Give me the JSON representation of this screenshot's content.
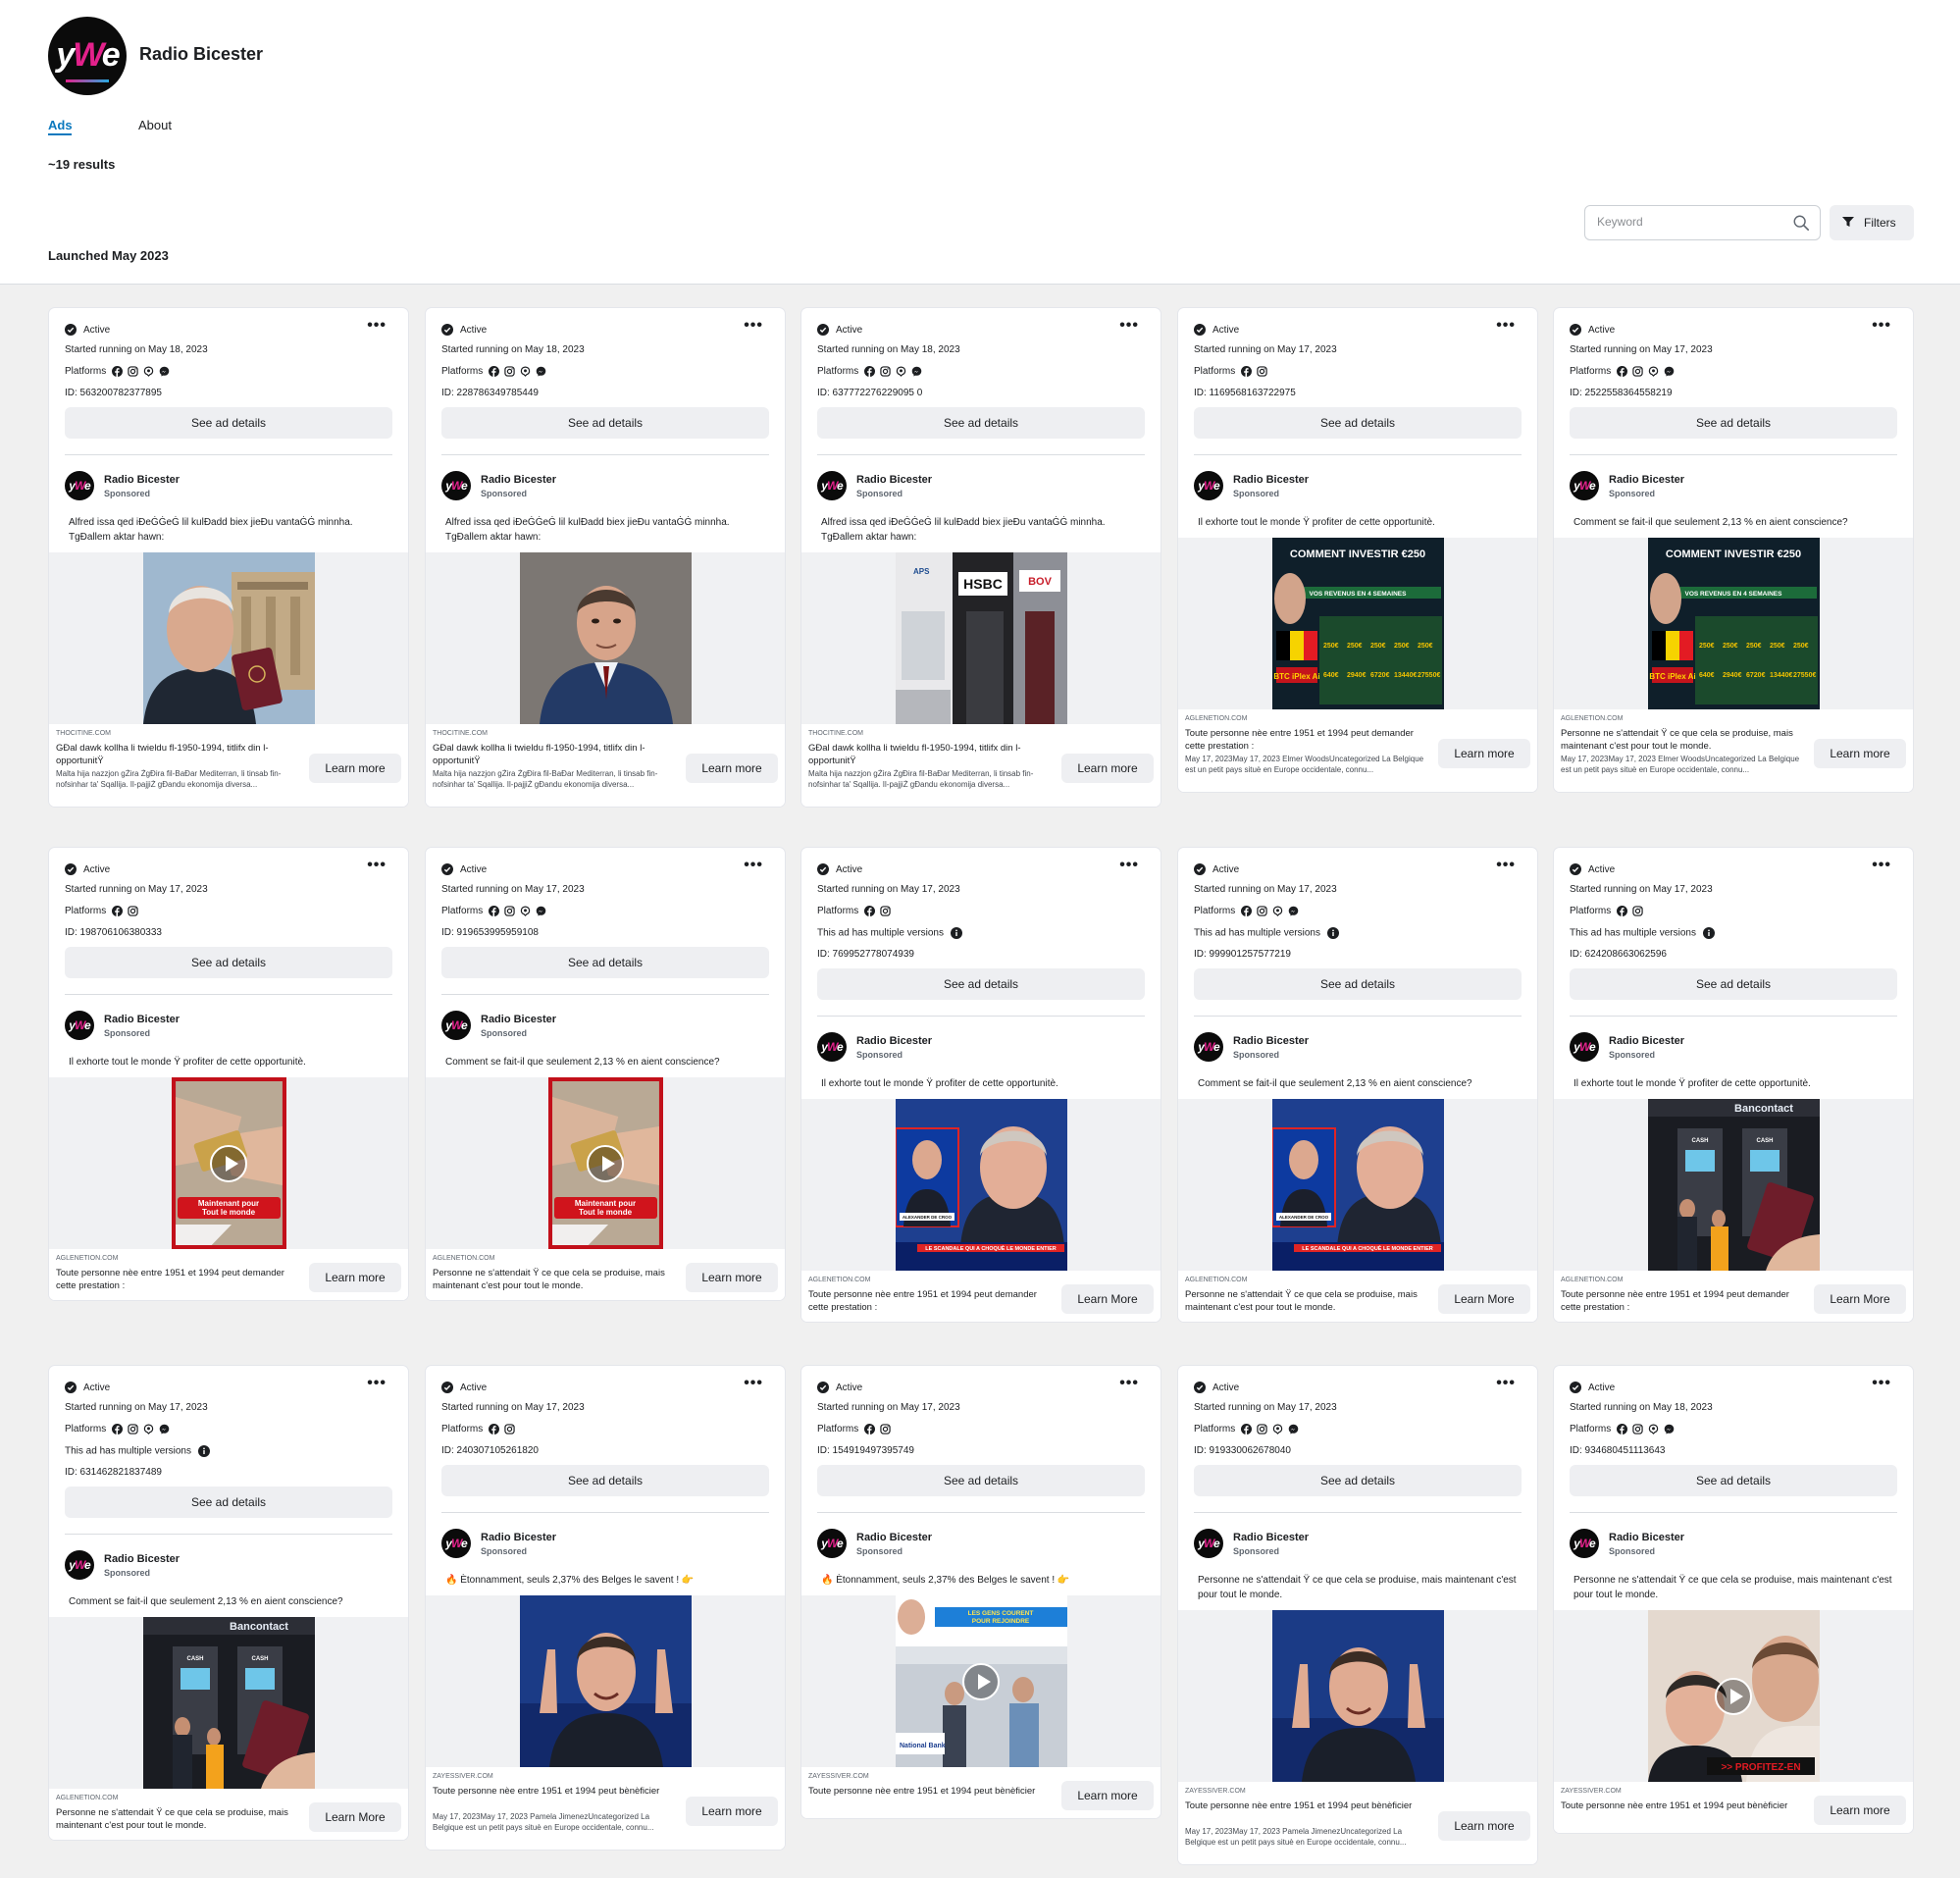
{
  "page": {
    "name": "Radio Bicester",
    "tabs": [
      "Ads",
      "About"
    ],
    "result_count": "~19 results",
    "section_title": "Launched May 2023",
    "search_placeholder": "Keyword",
    "filters_label": "Filters"
  },
  "labels": {
    "status": "Active",
    "platforms": "Platforms",
    "multiple_versions": "This ad has multiple versions",
    "see_details": "See ad details",
    "sponsored": "Sponsored"
  },
  "colors": {
    "link_blue": "#0a78be",
    "button_gray": "#eeeff2",
    "brand_pink": "#e3218b",
    "brand_blue": "#27aae1"
  },
  "cards": [
    {
      "started": "Started running on May 18, 2023",
      "platform_icons": [
        "facebook-icon",
        "instagram-icon",
        "audience-network-icon",
        "messenger-icon"
      ],
      "multiple_versions": false,
      "id": "ID: 563200782377895",
      "body": "Alfred issa qed iÐeĠĠeĠ lil kulÐadd biex jieÐu vantaĠĠ minnha. TgÐallem aktar hawn:",
      "media": "man-passport",
      "video": false,
      "domain": "THOCITINE.COM",
      "headline": "GÐal dawk kollha li twieldu fl-1950-1994, titlifx din l-opportunitŸ",
      "description": "Malta hija nazzjon gŻira ŻgÐira fil-BaÐar Mediterran, li tinsab fin-nofsinhar ta' Sqallija. Il-pajjiŻ gÐandu ekonomija diversa...",
      "cta": "Learn more"
    },
    {
      "started": "Started running on May 18, 2023",
      "platform_icons": [
        "facebook-icon",
        "instagram-icon",
        "audience-network-icon",
        "messenger-icon"
      ],
      "multiple_versions": false,
      "id": "ID: 228786349785449",
      "body": "Alfred issa qed iÐeĠĠeĠ lil kulÐadd biex jieÐu vantaĠĠ minnha. TgÐallem aktar hawn:",
      "media": "man-speaking",
      "video": false,
      "domain": "THOCITINE.COM",
      "headline": "GÐal dawk kollha li twieldu fl-1950-1994, titlifx din l-opportunitŸ",
      "description": "Malta hija nazzjon gŻira ŻgÐira fil-BaÐar Mediterran, li tinsab fin-nofsinhar ta' Sqallija. Il-pajjiŻ gÐandu ekonomija diversa...",
      "cta": "Learn more"
    },
    {
      "started": "Started running on May 18, 2023",
      "platform_icons": [
        "facebook-icon",
        "instagram-icon",
        "audience-network-icon",
        "messenger-icon"
      ],
      "multiple_versions": false,
      "id": "ID: 637772276229095 0",
      "body": "Alfred issa qed iÐeĠĠeĠ lil kulÐadd biex jieÐu vantaĠĠ minnha. TgÐallem aktar hawn:",
      "media": "bank-street",
      "video": false,
      "media_words": [
        "HSBC",
        "BOV",
        "APS"
      ],
      "domain": "THOCITINE.COM",
      "headline": "GÐal dawk kollha li twieldu fl-1950-1994, titlifx din l-opportunitŸ",
      "description": "Malta hija nazzjon gŻira ŻgÐira fil-BaÐar Mediterran, li tinsab fin-nofsinhar ta' Sqallija. Il-pajjiŻ gÐandu ekonomija diversa...",
      "cta": "Learn more"
    },
    {
      "started": "Started running on May 17, 2023",
      "platform_icons": [
        "facebook-icon",
        "instagram-icon"
      ],
      "multiple_versions": false,
      "id": "ID: 1169568163722975",
      "body": "Il exhorte tout le monde Ÿ profiter de cette opportunitè.",
      "media": "invest-chart",
      "video": false,
      "media_words": [
        "COMMENT INVESTIR €250",
        "VOS REVENUS EN 4 SEMAINES"
      ],
      "domain": "AGLENETION.COM",
      "headline": "Toute personne nèe entre 1951 et 1994 peut demander cette prestation :",
      "description": "May 17, 2023May 17, 2023 Elmer WoodsUncategorized La Belgique est un petit pays situè en Europe occidentale, connu...",
      "cta": "Learn more"
    },
    {
      "started": "Started running on May 17, 2023",
      "platform_icons": [
        "facebook-icon",
        "instagram-icon",
        "audience-network-icon",
        "messenger-icon"
      ],
      "multiple_versions": false,
      "id": "ID: 2522558364558219",
      "body": "Comment se fait-il que seulement 2,13 % en aient conscience?",
      "media": "invest-chart",
      "video": false,
      "media_words": [
        "COMMENT INVESTIR €250",
        "VOS REVENUS EN 4 SEMAINES"
      ],
      "domain": "AGLENETION.COM",
      "headline": "Personne ne s'attendait Ÿ ce que cela se produise, mais maintenant c'est pour tout le monde.",
      "description": "May 17, 2023May 17, 2023 Elmer WoodsUncategorized La Belgique est un petit pays situè en Europe occidentale, connu...",
      "cta": "Learn more"
    },
    {
      "started": "Started running on May 17, 2023",
      "platform_icons": [
        "facebook-icon",
        "instagram-icon"
      ],
      "multiple_versions": false,
      "id": "ID: 198706106380333",
      "body": "Il exhorte tout le monde Ÿ profiter de cette opportunitè.",
      "media": "card-hands",
      "video": true,
      "media_words": [
        "Maintenant pour",
        "Tout le monde"
      ],
      "domain": "AGLENETION.COM",
      "headline": "Toute personne nèe entre 1951 et 1994 peut demander cette prestation :",
      "description": "",
      "cta": "Learn more"
    },
    {
      "started": "Started running on May 17, 2023",
      "platform_icons": [
        "facebook-icon",
        "instagram-icon",
        "audience-network-icon",
        "messenger-icon"
      ],
      "multiple_versions": false,
      "id": "ID: 919653995959108",
      "body": "Comment se fait-il que seulement 2,13 % en aient conscience?",
      "media": "card-hands",
      "video": true,
      "media_words": [
        "Maintenant pour",
        "Tout le monde"
      ],
      "domain": "AGLENETION.COM",
      "headline": "Personne ne s'attendait Ÿ ce que cela se produise, mais maintenant c'est pour tout le monde.",
      "description": "",
      "cta": "Learn more"
    },
    {
      "started": "Started running on May 17, 2023",
      "platform_icons": [
        "facebook-icon",
        "instagram-icon"
      ],
      "multiple_versions": true,
      "id": "ID: 769952778074939",
      "body": "Il exhorte tout le monde Ÿ profiter de cette opportunitè.",
      "media": "tv-news",
      "video": false,
      "media_words": [
        "ALEXANDER DE CROO",
        "LE SCANDALE QUI A CHOQUÈ LE MONDE ENTIER"
      ],
      "domain": "AGLENETION.COM",
      "headline": "Toute personne nèe entre 1951 et 1994 peut demander cette prestation :",
      "description": "",
      "cta": "Learn More"
    },
    {
      "started": "Started running on May 17, 2023",
      "platform_icons": [
        "facebook-icon",
        "instagram-icon",
        "audience-network-icon",
        "messenger-icon"
      ],
      "multiple_versions": true,
      "id": "ID: 999901257577219",
      "body": "Comment se fait-il que seulement 2,13 % en aient conscience?",
      "media": "tv-news",
      "video": false,
      "media_words": [
        "ALEXANDER DE CROO",
        "LE SCANDALE QUI A CHOQUÈ LE MONDE ENTIER"
      ],
      "domain": "AGLENETION.COM",
      "headline": "Personne ne s'attendait Ÿ ce que cela se produise, mais maintenant c'est pour tout le monde.",
      "description": "",
      "cta": "Learn More"
    },
    {
      "started": "Started running on May 17, 2023",
      "platform_icons": [
        "facebook-icon",
        "instagram-icon"
      ],
      "multiple_versions": true,
      "id": "ID: 624208663062596",
      "body": "Il exhorte tout le monde Ÿ profiter de cette opportunitè.",
      "media": "bancontact-atm",
      "video": false,
      "media_words": [
        "Bancontact",
        "CASH"
      ],
      "domain": "AGLENETION.COM",
      "headline": "Toute personne nèe entre 1951 et 1994 peut demander cette prestation :",
      "description": "",
      "cta": "Learn More"
    },
    {
      "started": "Started running on May 17, 2023",
      "platform_icons": [
        "facebook-icon",
        "instagram-icon",
        "audience-network-icon",
        "messenger-icon"
      ],
      "multiple_versions": true,
      "id": "ID: 631462821837489",
      "body": "Comment se fait-il que seulement 2,13 % en aient conscience?",
      "media": "bancontact-atm",
      "video": false,
      "media_words": [
        "Bancontact",
        "CASH"
      ],
      "domain": "AGLENETION.COM",
      "headline": "Personne ne s'attendait Ÿ ce que cela se produise, mais maintenant c'est pour tout le monde.",
      "description": "",
      "cta": "Learn More"
    },
    {
      "started": "Started running on May 17, 2023",
      "platform_icons": [
        "facebook-icon",
        "instagram-icon"
      ],
      "multiple_versions": false,
      "id": "ID: 240307105261820",
      "body": "🔥 Ètonnamment, seuls 2,37% des Belges le savent ! 👉",
      "media": "man-pointing",
      "video": false,
      "domain": "ZAYESSIVER.COM",
      "headline": "Toute personne nèe entre 1951 et 1994 peut bènèficier",
      "description": "May 17, 2023May 17, 2023 Pamela JimenezUncategorized La Belgique est un petit pays situè en Europe occidentale, connu...",
      "cta": "Learn more"
    },
    {
      "started": "Started running on May 17, 2023",
      "platform_icons": [
        "facebook-icon",
        "instagram-icon"
      ],
      "multiple_versions": false,
      "id": "ID: 154919497395749",
      "body": "🔥 Ètonnamment, seuls 2,37% des Belges le savent ! 👉",
      "media": "bank-queue",
      "video": true,
      "media_words": [
        "LES GENS COURENT POUR REJOINDRE",
        "National Bank"
      ],
      "domain": "ZAYESSIVER.COM",
      "headline": "Toute personne nèe entre 1951 et 1994 peut bènèficier",
      "description": "",
      "cta": "Learn more"
    },
    {
      "started": "Started running on May 17, 2023",
      "platform_icons": [
        "facebook-icon",
        "instagram-icon",
        "audience-network-icon",
        "messenger-icon"
      ],
      "multiple_versions": false,
      "id": "ID: 919330062678040",
      "body": "Personne ne s'attendait Ÿ ce que cela se produise, mais maintenant c'est pour tout le monde.",
      "media": "man-pointing",
      "video": false,
      "domain": "ZAYESSIVER.COM",
      "headline": "Toute personne nèe entre 1951 et 1994 peut bènèficier",
      "description": "May 17, 2023May 17, 2023 Pamela JimenezUncategorized La Belgique est un petit pays situè en Europe occidentale, connu...",
      "cta": "Learn more"
    },
    {
      "started": "Started running on May 18, 2023",
      "platform_icons": [
        "facebook-icon",
        "instagram-icon",
        "audience-network-icon",
        "messenger-icon"
      ],
      "multiple_versions": false,
      "id": "ID: 934680451113643",
      "body": "Personne ne s'attendait Ÿ ce que cela se produise, mais maintenant c'est pour tout le monde.",
      "media": "two-men",
      "video": true,
      "media_words": [
        ">> PROFITEZ-EN"
      ],
      "domain": "ZAYESSIVER.COM",
      "headline": "Toute personne nèe entre 1951 et 1994 peut bènèficier",
      "description": "",
      "cta": "Learn more"
    }
  ]
}
